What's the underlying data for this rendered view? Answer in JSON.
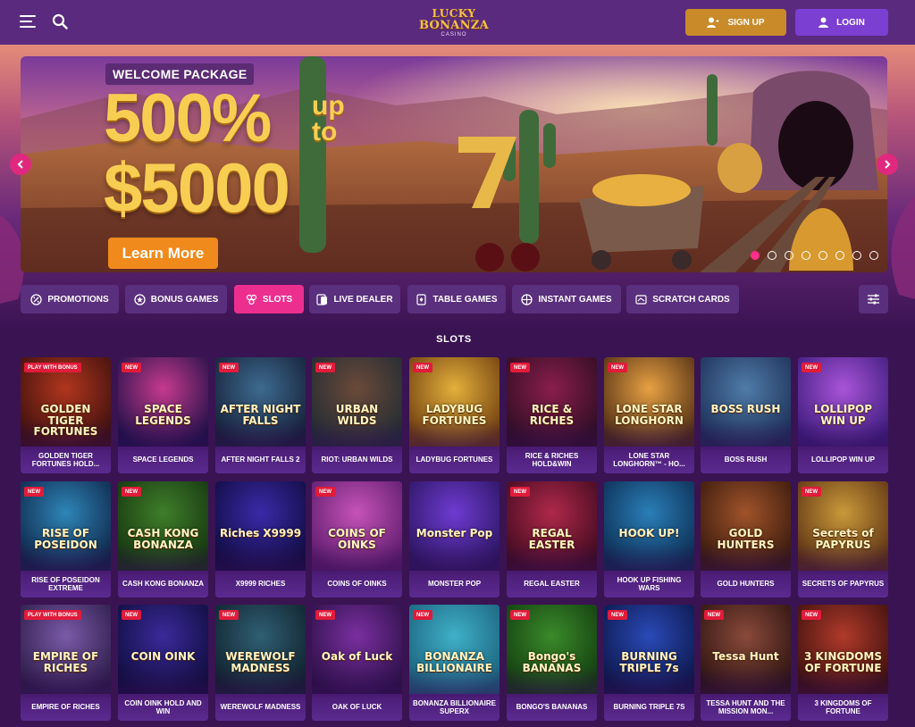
{
  "header": {
    "logo": {
      "line1": "LUCKY",
      "line2": "BONANZA",
      "line3": "CASINO"
    },
    "signup_label": "SIGN UP",
    "login_label": "LOGIN"
  },
  "banner": {
    "welcome_label": "WELCOME PACKAGE",
    "headline_percent": "500%",
    "headline_upto_1": "up",
    "headline_upto_2": "to",
    "headline_amount": "$5000",
    "cta_label": "Learn More",
    "slide_count": 8,
    "active_slide": 1
  },
  "categories": [
    {
      "label": "PROMOTIONS",
      "icon": "promotions-icon"
    },
    {
      "label": "BONUS GAMES",
      "icon": "bonus-games-icon"
    },
    {
      "label": "SLOTS",
      "icon": "slots-icon",
      "active": true
    },
    {
      "label": "LIVE DEALER",
      "icon": "live-dealer-icon"
    },
    {
      "label": "TABLE GAMES",
      "icon": "table-games-icon"
    },
    {
      "label": "INSTANT GAMES",
      "icon": "instant-games-icon"
    },
    {
      "label": "SCRATCH CARDS",
      "icon": "scratch-cards-icon"
    }
  ],
  "section_title": "SLOTS",
  "games": [
    {
      "name": "GOLDEN TIGER FORTUNES HOLD...",
      "art_title": "GOLDEN TIGER FORTUNES",
      "badge": "PLAY WITH BONUS",
      "colors": [
        "#b2361e",
        "#3a0f0d"
      ]
    },
    {
      "name": "SPACE LEGENDS",
      "art_title": "SPACE LEGENDS",
      "badge": "NEW",
      "colors": [
        "#c63a8e",
        "#1b0f45"
      ]
    },
    {
      "name": "AFTER NIGHT FALLS 2",
      "art_title": "AFTER NIGHT FALLS",
      "badge": "NEW",
      "colors": [
        "#3d6b8f",
        "#141d35"
      ]
    },
    {
      "name": "RIOT: URBAN WILDS",
      "art_title": "URBAN WILDS",
      "badge": "NEW",
      "colors": [
        "#6b4a39",
        "#1f2a33"
      ]
    },
    {
      "name": "LADYBUG FORTUNES",
      "art_title": "LADYBUG FORTUNES",
      "badge": "NEW",
      "colors": [
        "#e3b03b",
        "#6b3a0e"
      ]
    },
    {
      "name": "RICE & RICHES HOLD&WIN",
      "art_title": "RICE & RICHES",
      "badge": "NEW",
      "colors": [
        "#8a1e4c",
        "#2b0d22"
      ]
    },
    {
      "name": "LONE STAR LONGHORN™ - HO...",
      "art_title": "LONE STAR LONGHORN",
      "badge": "NEW",
      "colors": [
        "#e7a143",
        "#4a2a12"
      ]
    },
    {
      "name": "BOSS RUSH",
      "art_title": "BOSS RUSH",
      "badge": "",
      "colors": [
        "#4f7ca8",
        "#1b2d55"
      ]
    },
    {
      "name": "LOLLIPOP WIN UP",
      "art_title": "LOLLIPOP WIN UP",
      "badge": "NEW",
      "colors": [
        "#a954d8",
        "#3a1a7a"
      ]
    },
    {
      "name": "RISE OF POSEIDON EXTREME",
      "art_title": "RISE OF POSEIDON",
      "badge": "NEW",
      "colors": [
        "#2e86b8",
        "#0e2245"
      ]
    },
    {
      "name": "CASH KONG BONANZA",
      "art_title": "CASH KONG BONANZA",
      "badge": "NEW",
      "colors": [
        "#3f7e2a",
        "#14330f"
      ]
    },
    {
      "name": "X9999 RICHES",
      "art_title": "Riches X9999",
      "badge": "",
      "colors": [
        "#3a2aa8",
        "#0f0b3d"
      ]
    },
    {
      "name": "COINS OF OINKS",
      "art_title": "COINS OF OINKS",
      "badge": "NEW",
      "colors": [
        "#c653b8",
        "#5a1a6a"
      ]
    },
    {
      "name": "MONSTER POP",
      "art_title": "Monster Pop",
      "badge": "",
      "colors": [
        "#6e3bd1",
        "#2a145e"
      ]
    },
    {
      "name": "REGAL EASTER",
      "art_title": "REGAL EASTER",
      "badge": "NEW",
      "colors": [
        "#b0284a",
        "#3d0a1f"
      ]
    },
    {
      "name": "HOOK UP FISHING WARS",
      "art_title": "HOOK UP!",
      "badge": "",
      "colors": [
        "#2a7fb8",
        "#0b2a4f"
      ]
    },
    {
      "name": "GOLD HUNTERS",
      "art_title": "GOLD HUNTERS",
      "badge": "",
      "colors": [
        "#a0532a",
        "#35180c"
      ]
    },
    {
      "name": "SECRETS OF PAPYRUS",
      "art_title": "Secrets of PAPYRUS",
      "badge": "NEW",
      "colors": [
        "#c99a3a",
        "#5a2f12"
      ]
    },
    {
      "name": "EMPIRE OF RICHES",
      "art_title": "EMPIRE OF RICHES",
      "badge": "PLAY WITH BONUS",
      "colors": [
        "#7a5aa8",
        "#2a1a45"
      ]
    },
    {
      "name": "COIN OINK HOLD AND WIN",
      "art_title": "COIN OINK",
      "badge": "NEW",
      "colors": [
        "#3a2a9a",
        "#0e0c3a"
      ]
    },
    {
      "name": "WEREWOLF MADNESS",
      "art_title": "WEREWOLF MADNESS",
      "badge": "NEW",
      "colors": [
        "#2f5f73",
        "#0f1f2a"
      ]
    },
    {
      "name": "OAK OF LUCK",
      "art_title": "Oak of Luck",
      "badge": "NEW",
      "colors": [
        "#7a2fa0",
        "#2a0f45"
      ]
    },
    {
      "name": "BONANZA BILLIONAIRE SUPERX",
      "art_title": "BONANZA BILLIONAIRE",
      "badge": "NEW",
      "colors": [
        "#3fb0c8",
        "#1a5f7a"
      ]
    },
    {
      "name": "BONGO'S BANANAS",
      "art_title": "Bongo's BANANAS",
      "badge": "NEW",
      "colors": [
        "#3a8a2a",
        "#123a0f"
      ]
    },
    {
      "name": "BURNING TRIPLE 7S",
      "art_title": "BURNING TRIPLE 7s",
      "badge": "NEW",
      "colors": [
        "#2a4ab8",
        "#0b1545"
      ]
    },
    {
      "name": "TESSA HUNT AND THE MISSION MON...",
      "art_title": "Tessa Hunt",
      "badge": "NEW",
      "colors": [
        "#8a4a3a",
        "#2a1210"
      ]
    },
    {
      "name": "3 KINGDOMS OF FORTUNE",
      "art_title": "3 KINGDOMS OF FORTUNE",
      "badge": "NEW",
      "colors": [
        "#b03a2a",
        "#3a0f0d"
      ]
    }
  ]
}
